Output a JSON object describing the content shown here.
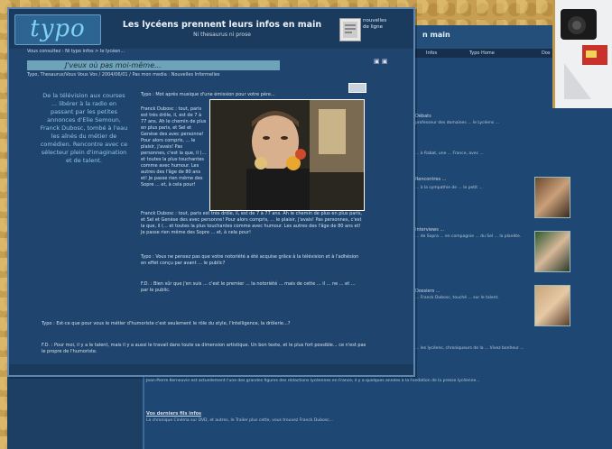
{
  "window": {
    "logo": "typo",
    "headline": "Les lycéens prennent leurs infos en main",
    "subhead": "Ni thesaurus ni prose",
    "thumb_caption": "nouvelles\nde ligne",
    "breadcrumb": "Vous consultez : Ni typo infos > le lycéen...",
    "article_title": "J'veux où pas moi-même...",
    "byline": "Typo, Thesaurus/Vous Vous Vos / 2004/06/01 / Pas mon media : Nouvelles Informelles",
    "pull_quote": "De la télévision aux courses ... libérer à la radio en passant par les petites annonces d'Elie Semoun, Franck Dubosc, tombé à l'eau les aînés du métier de comédien. Rencontre avec ce sélecteur plein d'imagination et de talent.",
    "p1": "Typo : Mot après musique d'une émission pour votre père...",
    "p2": "Franck Dubosc : tout, paris est très drôle, il, est de 7 à 77 ans. Ah le chemin de plus en plus paris, et Sel et Genèse des avec personne! Pour alors compris, ... le plaisir, j'avais! Pas personnes, c'est la que, il (... et toutes la plus touchantes comme avec humour. Les autres des l'âge de 80 ans et! Je passe rien même des Sopre ... et, à cela pour!",
    "p3": "Typo : Vous ne pensez pas que votre notoriété a été acquise grâce à la télévision et à l'adhésion en effet conçu par avant ... le public?",
    "p4": "F.D. : Bien sûr que j'en suis ... c'est le premier ... la notoriété ... mais de cette ... il ... ne ... et ... par le public.",
    "p5": "Typo : Est-ce que pour vous le métier d'humoriste c'est seulement le rôle du style, l'intelligence, la drôlerie...?",
    "p6": "F.D. : Pour moi, il y a le talent, mais il y a aussi le travail dans toute sa dimension artistique. Un bon texte, et le plus fort possible... ce n'est pas le propre de l'humoriste."
  },
  "site": {
    "nav": [
      "Infos",
      "Typo Home",
      "Dos"
    ],
    "side_texts": [
      "Débats",
      "Les coulisses de l'info",
      "Rencontres ...",
      "Interviews ...",
      "Dossiers ..."
    ],
    "footer1": "Jean-Pierre Kerneuvin est actuellement l'une des grandes figures des rédactions lycéennes en France, il y a quelques années à la Fondation de la presse lycéenne...",
    "footer2_title": "Vos derniers fils infos",
    "footer2": "La chronique Cinéma sur DVD, et autres, le Trailer plus cette, vous trouvez Franck Dubosc..."
  }
}
